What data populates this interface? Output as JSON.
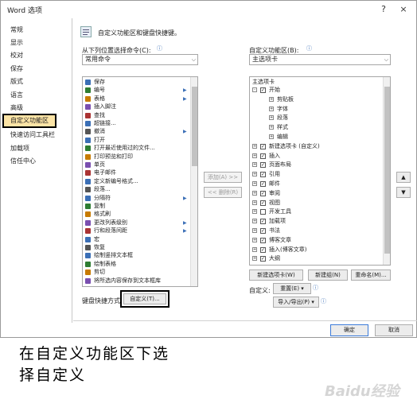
{
  "window": {
    "title": "Word 选项",
    "help": "?",
    "close": "×"
  },
  "sidebar": {
    "items": [
      "常规",
      "显示",
      "校对",
      "保存",
      "版式",
      "语言",
      "高级",
      "自定义功能区",
      "快速访问工具栏",
      "加载项",
      "信任中心"
    ],
    "active_index": 7
  },
  "header": {
    "text": "自定义功能区和键盘快捷键。"
  },
  "left": {
    "label": "从下列位置选择命令(C):",
    "select_value": "常用命令",
    "commands": [
      "保存",
      "编号",
      "表格",
      "插入脚注",
      "查找",
      "超链接...",
      "撤消",
      "打开",
      "打开最近使用过的文件...",
      "打印预览和打印",
      "单页",
      "电子邮件",
      "定义新编号格式...",
      "段落...",
      "分隔符",
      "复制",
      "格式刷",
      "更改列表级别",
      "行和段落间距",
      "宏",
      "恢复",
      "绘制竖排文本框",
      "绘制表格",
      "剪切",
      "将所选内容保存到文本框库"
    ]
  },
  "middle": {
    "add": "添加(A) >>",
    "remove": "<< 删除(R)"
  },
  "right": {
    "label": "自定义功能区(B):",
    "select_value": "主选项卡",
    "list_header": "主选项卡",
    "tree": [
      {
        "text": "开始",
        "level": 0,
        "expand": "-",
        "checked": true
      },
      {
        "text": "剪贴板",
        "level": 1,
        "expand": "+",
        "checked": null
      },
      {
        "text": "字体",
        "level": 1,
        "expand": "+",
        "checked": null
      },
      {
        "text": "段落",
        "level": 1,
        "expand": "+",
        "checked": null
      },
      {
        "text": "样式",
        "level": 1,
        "expand": "+",
        "checked": null
      },
      {
        "text": "编辑",
        "level": 1,
        "expand": "+",
        "checked": null
      },
      {
        "text": "新建选项卡 (自定义)",
        "level": 0,
        "expand": "+",
        "checked": true
      },
      {
        "text": "插入",
        "level": 0,
        "expand": "+",
        "checked": true
      },
      {
        "text": "页面布局",
        "level": 0,
        "expand": "+",
        "checked": true
      },
      {
        "text": "引用",
        "level": 0,
        "expand": "+",
        "checked": true
      },
      {
        "text": "邮件",
        "level": 0,
        "expand": "+",
        "checked": true
      },
      {
        "text": "审阅",
        "level": 0,
        "expand": "+",
        "checked": true
      },
      {
        "text": "视图",
        "level": 0,
        "expand": "+",
        "checked": true
      },
      {
        "text": "开发工具",
        "level": 0,
        "expand": "+",
        "checked": false
      },
      {
        "text": "加载项",
        "level": 0,
        "expand": "+",
        "checked": true
      },
      {
        "text": "书法",
        "level": 0,
        "expand": "+",
        "checked": true
      },
      {
        "text": "博客文章",
        "level": 0,
        "expand": "+",
        "checked": true
      },
      {
        "text": "插入(博客文章)",
        "level": 0,
        "expand": "+",
        "checked": true
      },
      {
        "text": "大纲",
        "level": 0,
        "expand": "+",
        "checked": true
      }
    ],
    "new_tab": "新建选项卡(W)",
    "new_group": "新建组(N)",
    "rename": "重命名(M)...",
    "customize_label": "自定义:",
    "reset": "重置(E) ▾",
    "import_export": "导入/导出(P) ▾",
    "up": "▲",
    "down": "▼"
  },
  "keyboard": {
    "label": "键盘快捷方式:",
    "button": "自定义(T)..."
  },
  "footer": {
    "ok": "确定",
    "cancel": "取消"
  },
  "caption": {
    "line1": "在自定义功能区下选",
    "line2": "择自定义"
  },
  "watermark": "Baidu经验"
}
